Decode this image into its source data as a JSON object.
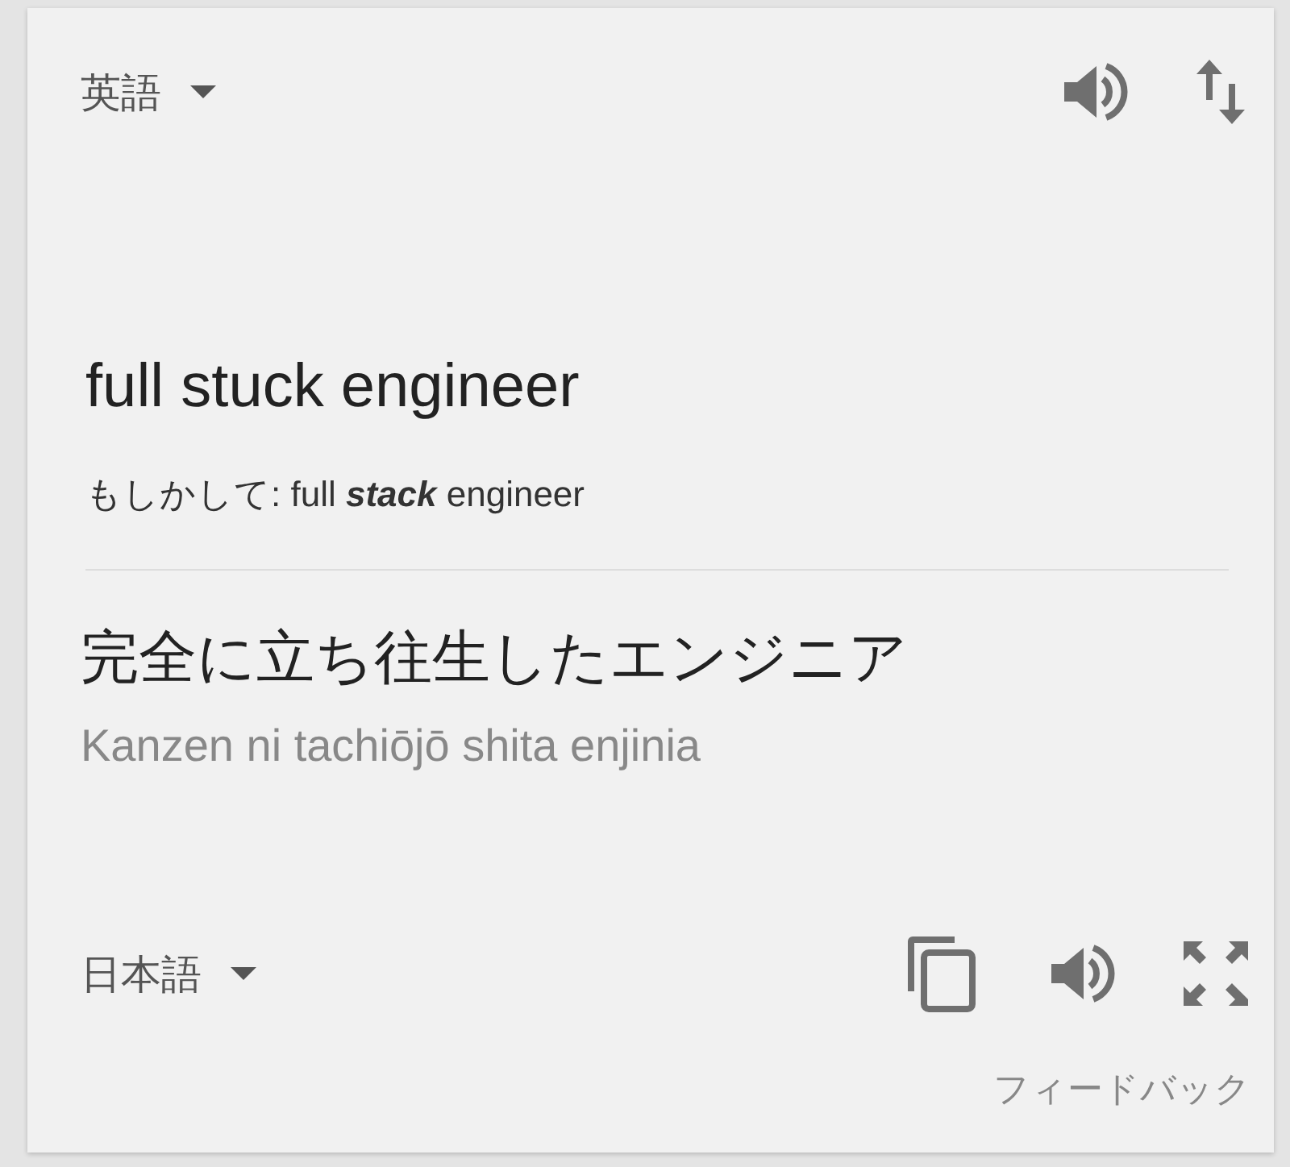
{
  "source": {
    "language": "英語",
    "text": "full stuck engineer",
    "suggestion": "もしかして: full **stack** engineer"
  },
  "target": {
    "text": "完全に立ち往生したエンジニア",
    "romanization": "Kanzen ni tachiōjō shita enjinia",
    "language": "日本語"
  },
  "feedback": "フィードバック"
}
